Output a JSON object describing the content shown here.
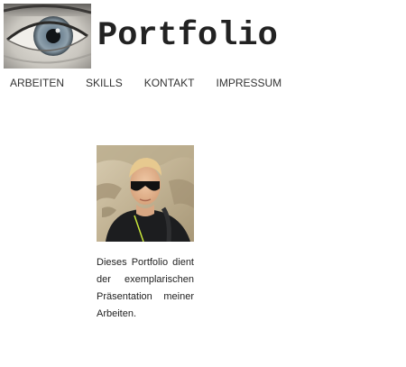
{
  "header": {
    "title": "Portfolio"
  },
  "nav": {
    "items": [
      {
        "label": "ARBEITEN"
      },
      {
        "label": "SKILLS"
      },
      {
        "label": "KONTAKT"
      },
      {
        "label": "IMPRESSUM"
      }
    ]
  },
  "main": {
    "intro_text": "Dieses Portfolio dient der exemplarischen Präsentation meiner Arbeiten."
  },
  "colors": {
    "background": "#ffffff",
    "text": "#222222",
    "nav_text": "#333333"
  }
}
